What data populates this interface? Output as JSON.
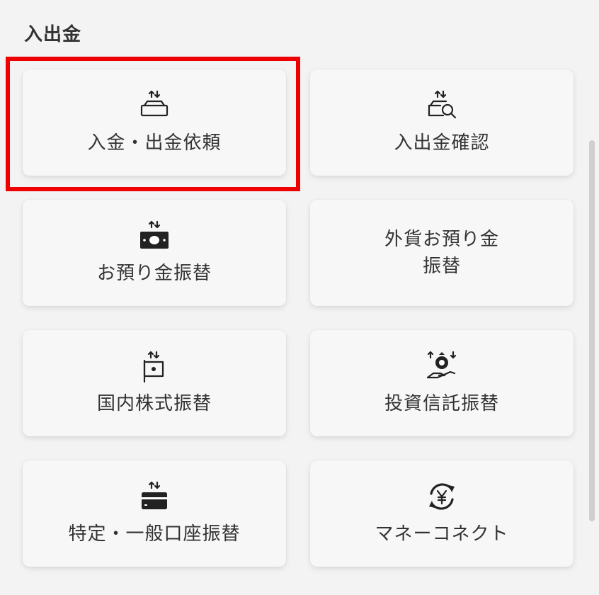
{
  "section": {
    "title": "入出金"
  },
  "tiles": [
    {
      "label": "入金・出金依頼",
      "icon": "tray-transfer-icon"
    },
    {
      "label": "入出金確認",
      "icon": "tray-search-icon"
    },
    {
      "label": "お預り金振替",
      "icon": "cash-transfer-icon"
    },
    {
      "label": "外貨お預り金\n振替",
      "icon": "foreign-currency-icon"
    },
    {
      "label": "国内株式振替",
      "icon": "stock-flag-icon"
    },
    {
      "label": "投資信託振替",
      "icon": "fund-hand-icon"
    },
    {
      "label": "特定・一般口座振替",
      "icon": "card-transfer-icon"
    },
    {
      "label": "マネーコネクト",
      "icon": "yen-cycle-icon"
    }
  ],
  "highlight_color": "#ee0000"
}
